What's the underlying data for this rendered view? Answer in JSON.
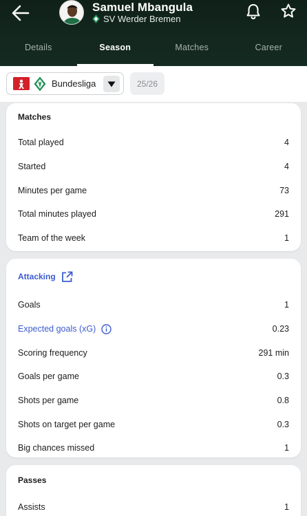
{
  "player": {
    "name": "Samuel Mbangula",
    "club": "SV Werder Bremen"
  },
  "icons": {
    "back": "arrow-left-icon",
    "notifications": "bell-icon",
    "favorite": "star-icon",
    "open": "external-link-icon",
    "info": "info-icon"
  },
  "tabs": [
    {
      "label": "Details"
    },
    {
      "label": "Season"
    },
    {
      "label": "Matches"
    },
    {
      "label": "Career"
    }
  ],
  "selector": {
    "league": "Bundesliga",
    "season": "25/26"
  },
  "sections": {
    "matches": {
      "title": "Matches",
      "rows": [
        {
          "label": "Total played",
          "value": "4"
        },
        {
          "label": "Started",
          "value": "4"
        },
        {
          "label": "Minutes per game",
          "value": "73"
        },
        {
          "label": "Total minutes played",
          "value": "291"
        },
        {
          "label": "Team of the week",
          "value": "1"
        }
      ]
    },
    "attacking": {
      "title": "Attacking",
      "rows": [
        {
          "label": "Goals",
          "value": "1"
        },
        {
          "label": "Expected goals (xG)",
          "value": "0.23"
        },
        {
          "label": "Scoring frequency",
          "value": "291 min"
        },
        {
          "label": "Goals per game",
          "value": "0.3"
        },
        {
          "label": "Shots per game",
          "value": "0.8"
        },
        {
          "label": "Shots on target per game",
          "value": "0.3"
        },
        {
          "label": "Big chances missed",
          "value": "1"
        }
      ]
    },
    "passes": {
      "title": "Passes",
      "rows": [
        {
          "label": "Assists",
          "value": "1"
        }
      ]
    }
  },
  "colors": {
    "header": "#13271e",
    "link": "#3c5bd1",
    "background": "#e9eaec",
    "bundesliga": "#d4202a",
    "werder": "#1d9053"
  }
}
